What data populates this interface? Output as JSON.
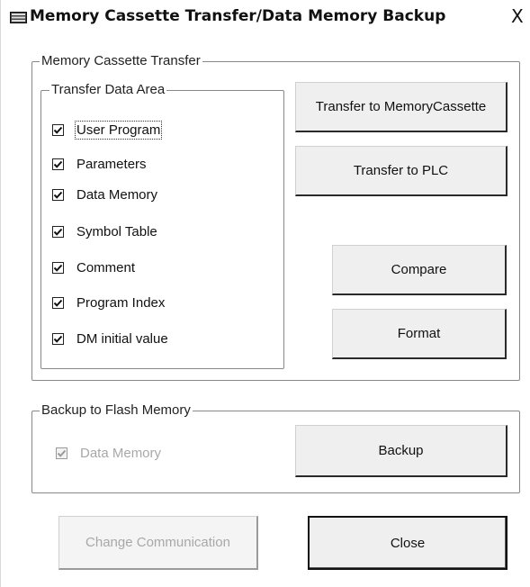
{
  "window": {
    "title": "Memory Cassette Transfer/Data Memory Backup",
    "close_glyph": "X",
    "icon": "memory-cassette-icon"
  },
  "cassette_group": {
    "legend": "Memory Cassette Transfer",
    "transfer_area": {
      "legend": "Transfer Data Area",
      "items": [
        {
          "label": "User Program",
          "checked": true
        },
        {
          "label": "Parameters",
          "checked": true
        },
        {
          "label": "Data Memory",
          "checked": true
        },
        {
          "label": "Symbol Table",
          "checked": true
        },
        {
          "label": "Comment",
          "checked": true
        },
        {
          "label": "Program Index",
          "checked": true
        },
        {
          "label": "DM initial value",
          "checked": true
        }
      ]
    },
    "buttons": {
      "transfer_to_cassette": "Transfer to MemoryCassette",
      "transfer_to_plc": "Transfer to PLC",
      "compare": "Compare",
      "format": "Format"
    }
  },
  "backup_group": {
    "legend": "Backup to Flash Memory",
    "data_memory": {
      "label": "Data Memory",
      "checked": true,
      "disabled": true
    },
    "backup_button": "Backup"
  },
  "footer": {
    "change_communication": "Change Communication",
    "close": "Close"
  }
}
